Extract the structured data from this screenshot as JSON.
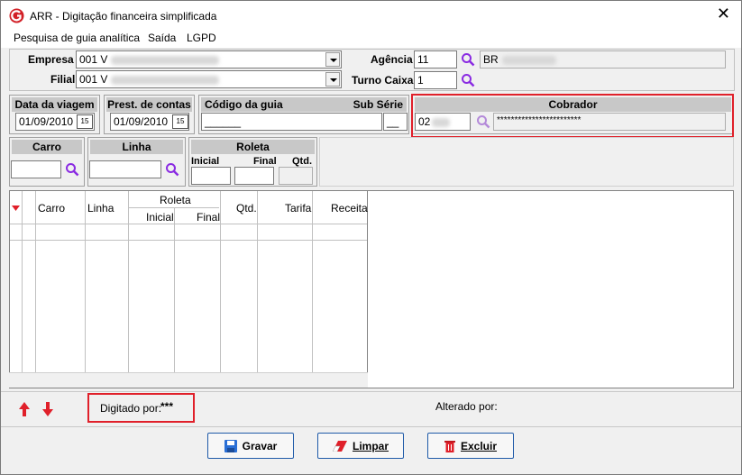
{
  "window": {
    "title": "ARR - Digitação financeira simplificada",
    "close_glyph": "✕"
  },
  "menu": [
    "Pesquisa de guia analítica",
    "Saída",
    "LGPD"
  ],
  "form": {
    "empresa_label": "Empresa",
    "empresa_value": "001 V",
    "filial_label": "Filial",
    "filial_value": "001 V",
    "agencia_label": "Agência",
    "agencia_value": "11",
    "agencia_desc": "BR",
    "turno_label": "Turno Caixa",
    "turno_value": "1"
  },
  "panels": {
    "data_viagem": {
      "label": "Data da viagem",
      "value": "01/09/2010"
    },
    "prest_contas": {
      "label": "Prest. de contas",
      "value": "01/09/2010"
    },
    "codigo_guia": {
      "label": "Código da guia",
      "value": "______",
      "sub_label": "Sub Série",
      "sub_value": "__"
    },
    "cobrador": {
      "label": "Cobrador",
      "code": "02",
      "desc": "************************"
    },
    "carro": {
      "label": "Carro"
    },
    "linha": {
      "label": "Linha"
    },
    "roleta": {
      "label": "Roleta",
      "inicial": "Inicial",
      "final": "Final",
      "qtd": "Qtd."
    }
  },
  "date_btn_glyph": "15",
  "grid": {
    "headers": {
      "carro": "Carro",
      "linha": "Linha",
      "roleta": "Roleta",
      "inicial": "Inicial",
      "final": "Final",
      "qtd": "Qtd.",
      "tarifa": "Tarifa",
      "receita": "Receita"
    }
  },
  "footer": {
    "digitado_label": "Digitado por:",
    "digitado_value": "***",
    "alterado_label": "Alterado por:"
  },
  "buttons": {
    "gravar": "Gravar",
    "limpar": "Limpar",
    "excluir": "Excluir"
  },
  "colors": {
    "accent_red": "#e0202a",
    "magnifier": "#8a2be2",
    "button_border": "#1f5aa8"
  }
}
